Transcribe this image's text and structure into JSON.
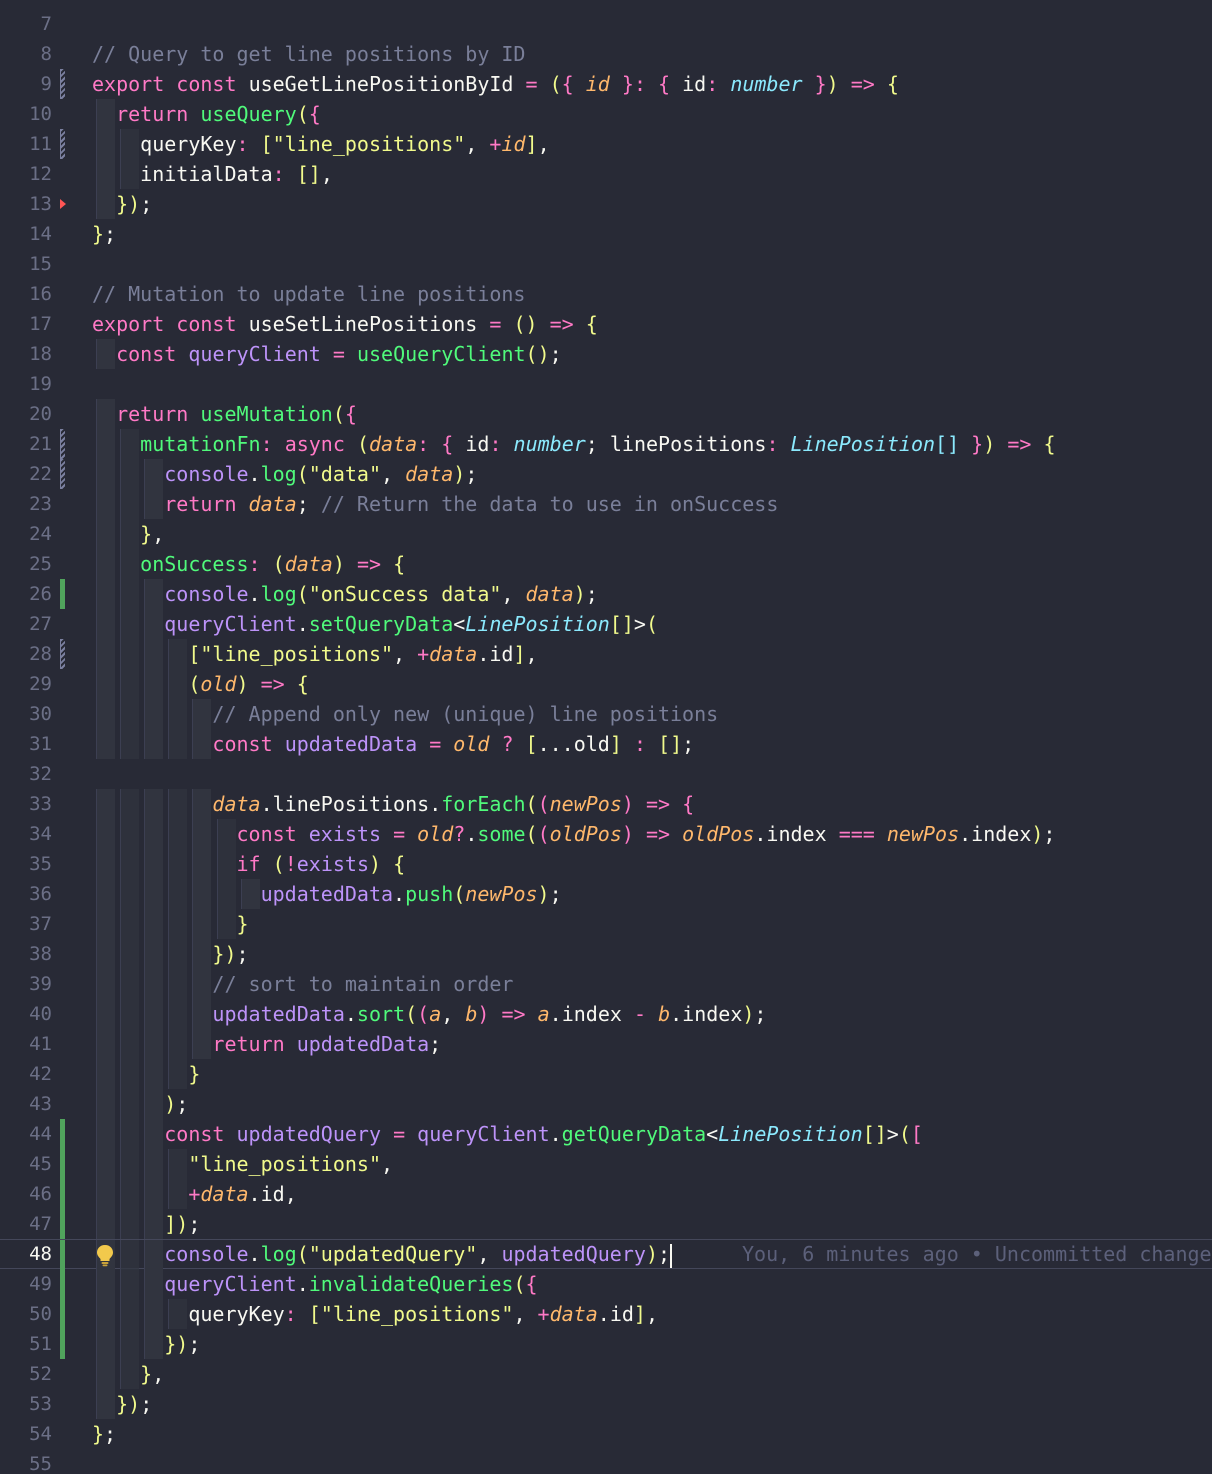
{
  "editor": {
    "active_line": 48,
    "blame": "You, 6 minutes ago • Uncommitted change",
    "lines": [
      {
        "n": "7",
        "mark": "",
        "code": ""
      },
      {
        "n": "8",
        "mark": "",
        "code": "// Query to get line positions by ID"
      },
      {
        "n": "9",
        "mark": "modified",
        "code": "export const useGetLinePositionById = ({ id }: { id: number }) => {"
      },
      {
        "n": "10",
        "mark": "",
        "code": "  return useQuery({"
      },
      {
        "n": "11",
        "mark": "modified",
        "code": "    queryKey: [\"line_positions\", +id],"
      },
      {
        "n": "12",
        "mark": "",
        "code": "    initialData: [],"
      },
      {
        "n": "13",
        "mark": "deleted",
        "code": "  });"
      },
      {
        "n": "14",
        "mark": "",
        "code": "};"
      },
      {
        "n": "15",
        "mark": "",
        "code": ""
      },
      {
        "n": "16",
        "mark": "",
        "code": "// Mutation to update line positions"
      },
      {
        "n": "17",
        "mark": "",
        "code": "export const useSetLinePositions = () => {"
      },
      {
        "n": "18",
        "mark": "",
        "code": "  const queryClient = useQueryClient();"
      },
      {
        "n": "19",
        "mark": "",
        "code": ""
      },
      {
        "n": "20",
        "mark": "",
        "code": "  return useMutation({"
      },
      {
        "n": "21",
        "mark": "modified",
        "code": "    mutationFn: async (data: { id: number; linePositions: LinePosition[] }) => {"
      },
      {
        "n": "22",
        "mark": "modified",
        "code": "      console.log(\"data\", data);"
      },
      {
        "n": "23",
        "mark": "",
        "code": "      return data; // Return the data to use in onSuccess"
      },
      {
        "n": "24",
        "mark": "",
        "code": "    },"
      },
      {
        "n": "25",
        "mark": "",
        "code": "    onSuccess: (data) => {"
      },
      {
        "n": "26",
        "mark": "added",
        "code": "      console.log(\"onSuccess data\", data);"
      },
      {
        "n": "27",
        "mark": "",
        "code": "      queryClient.setQueryData<LinePosition[]>("
      },
      {
        "n": "28",
        "mark": "modified",
        "code": "        [\"line_positions\", +data.id],"
      },
      {
        "n": "29",
        "mark": "",
        "code": "        (old) => {"
      },
      {
        "n": "30",
        "mark": "",
        "code": "          // Append only new (unique) line positions"
      },
      {
        "n": "31",
        "mark": "",
        "code": "          const updatedData = old ? [...old] : [];"
      },
      {
        "n": "32",
        "mark": "",
        "code": ""
      },
      {
        "n": "33",
        "mark": "",
        "code": "          data.linePositions.forEach((newPos) => {"
      },
      {
        "n": "34",
        "mark": "",
        "code": "            const exists = old?.some((oldPos) => oldPos.index === newPos.index);"
      },
      {
        "n": "35",
        "mark": "",
        "code": "            if (!exists) {"
      },
      {
        "n": "36",
        "mark": "",
        "code": "              updatedData.push(newPos);"
      },
      {
        "n": "37",
        "mark": "",
        "code": "            }"
      },
      {
        "n": "38",
        "mark": "",
        "code": "          });"
      },
      {
        "n": "39",
        "mark": "",
        "code": "          // sort to maintain order"
      },
      {
        "n": "40",
        "mark": "",
        "code": "          updatedData.sort((a, b) => a.index - b.index);"
      },
      {
        "n": "41",
        "mark": "",
        "code": "          return updatedData;"
      },
      {
        "n": "42",
        "mark": "",
        "code": "        }"
      },
      {
        "n": "43",
        "mark": "",
        "code": "      );"
      },
      {
        "n": "44",
        "mark": "added",
        "code": "      const updatedQuery = queryClient.getQueryData<LinePosition[]>(["
      },
      {
        "n": "45",
        "mark": "added",
        "code": "        \"line_positions\","
      },
      {
        "n": "46",
        "mark": "added",
        "code": "        +data.id,"
      },
      {
        "n": "47",
        "mark": "added",
        "code": "      ]);"
      },
      {
        "n": "48",
        "mark": "added",
        "code": "      console.log(\"updatedQuery\", updatedQuery);"
      },
      {
        "n": "49",
        "mark": "added",
        "code": "      queryClient.invalidateQueries({"
      },
      {
        "n": "50",
        "mark": "added",
        "code": "        queryKey: [\"line_positions\", +data.id],"
      },
      {
        "n": "51",
        "mark": "added",
        "code": "      });"
      },
      {
        "n": "52",
        "mark": "",
        "code": "    },"
      },
      {
        "n": "53",
        "mark": "",
        "code": "  });"
      },
      {
        "n": "54",
        "mark": "",
        "code": "};"
      },
      {
        "n": "55",
        "mark": "",
        "code": ""
      }
    ]
  }
}
